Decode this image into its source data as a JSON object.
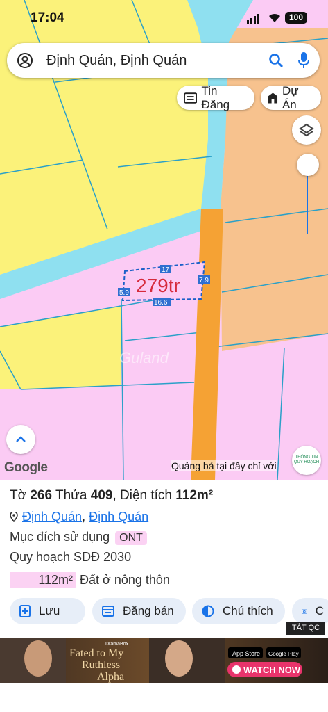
{
  "status_bar": {
    "time": "17:04",
    "battery": "100"
  },
  "search": {
    "query": "Định Quán, Định Quán"
  },
  "chips": {
    "tin_dang": "Tin Đăng",
    "du_an": "Dự Án"
  },
  "map": {
    "price_label": "279tr",
    "dimensions": {
      "top": "17",
      "right": "7.9",
      "left": "5.9",
      "bottom": "16.6"
    },
    "watermark": "Guland",
    "google_logo": "Google",
    "promo_text": "Quảng bá tại đây chỉ với",
    "planning_badge": "THÔNG TIN QUY HOẠCH"
  },
  "parcel": {
    "to_label": "Tờ",
    "to_number": "266",
    "thua_label": "Thửa",
    "thua_number": "409",
    "area_label": ", Diện tích",
    "area_value": "112m²",
    "location_1": "Định Quán",
    "location_sep": ",",
    "location_2": "Định Quán",
    "purpose_label": "Mục đích sử dụng",
    "purpose_code": "ONT",
    "plan_label": "Quy hoạch SDĐ 2030",
    "plan_area": "112m²",
    "plan_type": "Đất ở nông thôn"
  },
  "actions": {
    "save": "Lưu",
    "post": "Đăng bán",
    "legend": "Chú thích",
    "extra": "C"
  },
  "ad": {
    "close_label": "TẮT QC",
    "brand": "DramaBox",
    "headline_1": "Fated to My",
    "headline_2": "Ruthless",
    "headline_3": "Alpha",
    "store_1": "App Store",
    "store_2": "Google Play",
    "cta": "WATCH NOW"
  },
  "colors": {
    "land_yellow": "#fbf27a",
    "land_pink": "#fbcbf4",
    "land_orange": "#f7c28e",
    "water_cyan": "#8fe0f0",
    "road_orange": "#f5a234",
    "accent_blue": "#1a73e8",
    "parcel_red": "#d62a3c"
  }
}
